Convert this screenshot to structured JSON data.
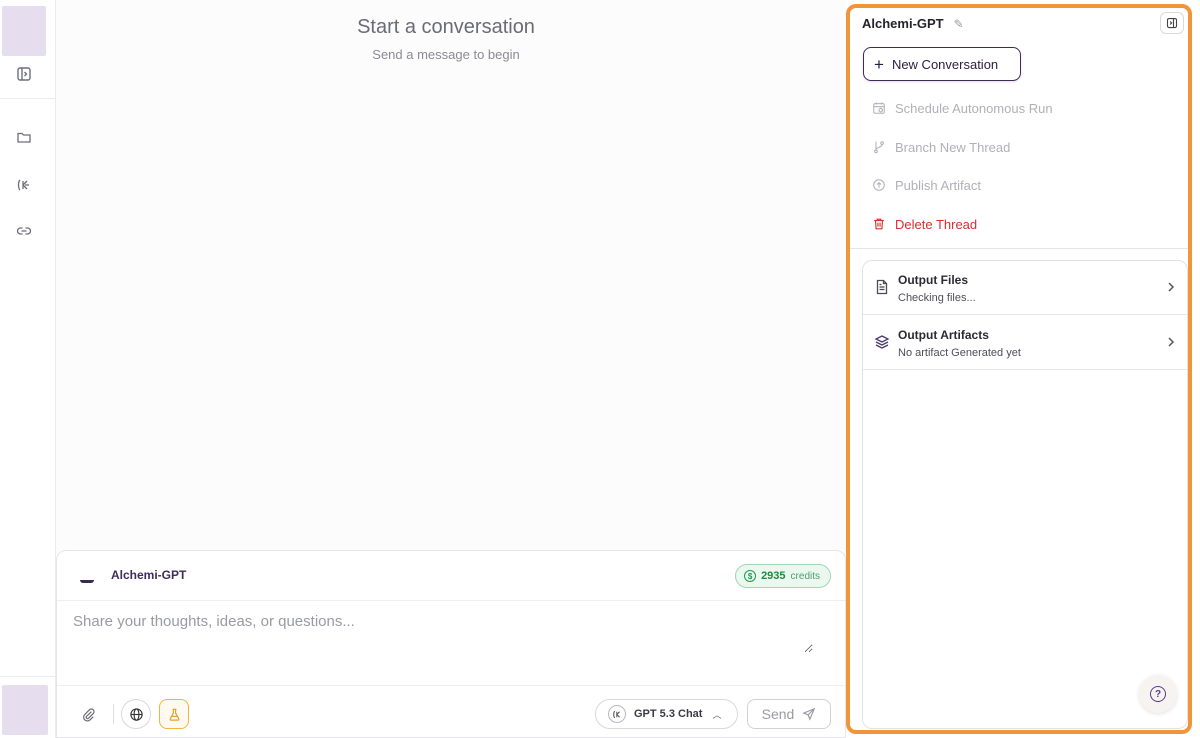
{
  "main": {
    "title": "Start a conversation",
    "subtitle": "Send a message to begin"
  },
  "composer": {
    "agent_name": "Alchemi-GPT",
    "credits_value": "2935",
    "credits_label": "credits",
    "placeholder": "Share your thoughts, ideas, or questions...",
    "model_label": "GPT 5.3 Chat",
    "send_label": "Send"
  },
  "panel": {
    "title": "Alchemi-GPT",
    "new_conversation_label": "New Conversation",
    "actions": [
      {
        "label": "Schedule Autonomous Run",
        "state": "disabled"
      },
      {
        "label": "Branch New Thread",
        "state": "disabled"
      },
      {
        "label": "Publish Artifact",
        "state": "disabled"
      },
      {
        "label": "Delete Thread",
        "state": "danger"
      }
    ],
    "outputs": [
      {
        "title": "Output Files",
        "subtitle": "Checking files..."
      },
      {
        "title": "Output Artifacts",
        "subtitle": "No artifact Generated yet"
      }
    ]
  },
  "colors": {
    "accent": "#3d2a58",
    "highlight_border": "#f0953a",
    "danger": "#d62f2f",
    "credits_green": "#1f8a45",
    "rail_tint": "#e6deee"
  },
  "icons": [
    "sidebar-toggle-icon",
    "folder-icon",
    "agent-icon",
    "link-icon",
    "paperclip-icon",
    "globe-icon",
    "flask-icon",
    "model-icon",
    "send-icon",
    "pencil-icon",
    "collapse-panel-icon",
    "calendar-icon",
    "branch-icon",
    "upload-icon",
    "trash-icon",
    "file-icon",
    "layers-icon",
    "chevron-right-icon",
    "help-icon"
  ]
}
